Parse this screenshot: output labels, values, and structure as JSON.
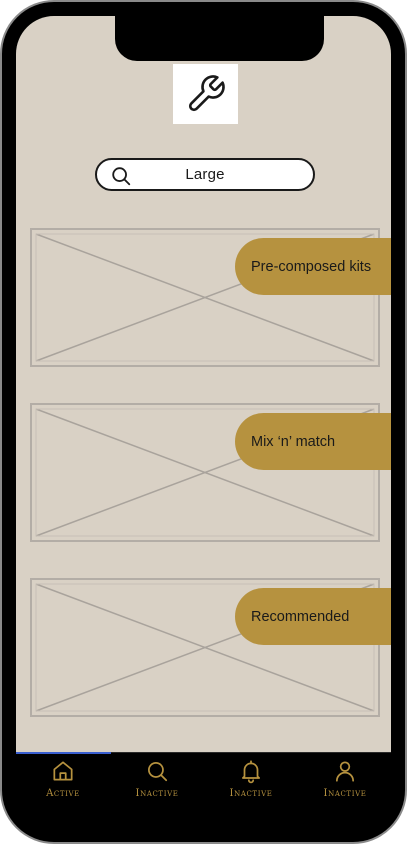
{
  "search": {
    "value": "Large"
  },
  "cards": [
    {
      "label": "Pre-composed kits"
    },
    {
      "label": "Mix ‘n’ match"
    },
    {
      "label": "Recommended"
    }
  ],
  "tabs": [
    {
      "label": "Active",
      "icon": "home-icon"
    },
    {
      "label": "Inactive",
      "icon": "search-icon"
    },
    {
      "label": "Inactive",
      "icon": "bell-icon"
    },
    {
      "label": "Inactive",
      "icon": "user-icon"
    }
  ],
  "colors": {
    "screen_bg": "#d9d1c5",
    "accent": "#b6923f",
    "tab_active_indicator": "#3a5fd0"
  }
}
